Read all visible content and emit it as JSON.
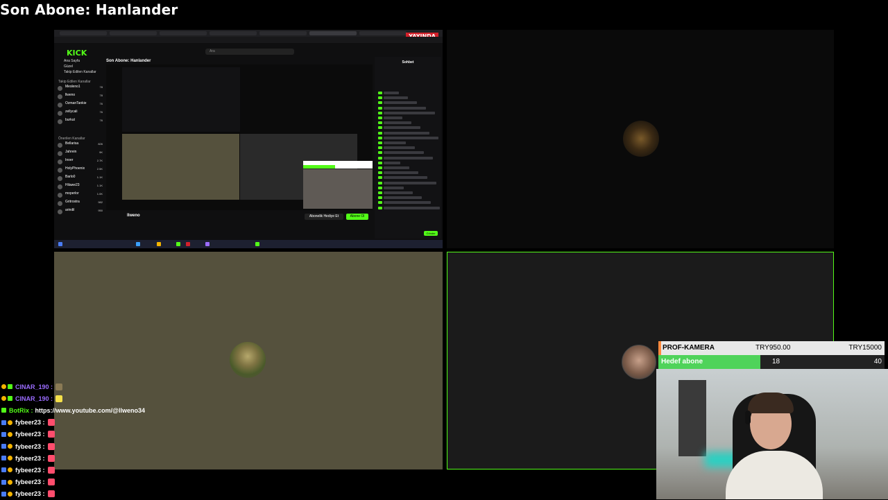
{
  "overlay": {
    "last_subscriber": "Son Abone: Hanlander"
  },
  "nested_screen": {
    "live_badge": "YAYINDA",
    "logo": "KICK",
    "search_placeholder": "Ara",
    "stream_title": "Son Abone: Hanlander",
    "streamer_name": "llweno",
    "chat_title": "Sohbet",
    "nav": [
      "Ana Sayfa",
      "Güzel",
      "Takip Edilen Kanallar"
    ],
    "followed_header": "Takip Edilen Kanallar",
    "followed": [
      {
        "name": "Mesleno1",
        "viewers": "78"
      },
      {
        "name": "llweno",
        "viewers": "78"
      },
      {
        "name": "OzmanTankie",
        "viewers": "76"
      },
      {
        "name": "zellycali",
        "viewers": "76"
      },
      {
        "name": "burkut",
        "viewers": "76"
      }
    ],
    "recommended_header": "Önerilen Kanallar",
    "recommended": [
      {
        "name": "Bellarisa",
        "viewers": "826"
      },
      {
        "name": "Jahrein",
        "viewers": "9K"
      },
      {
        "name": "Inoer",
        "viewers": "2.7K"
      },
      {
        "name": "HolyPhoenix",
        "viewers": "2.5K"
      },
      {
        "name": "Barlo0",
        "viewers": "1.1K"
      },
      {
        "name": "Hilawe23",
        "viewers": "1.1K"
      },
      {
        "name": "moperlor",
        "viewers": "1.0K"
      },
      {
        "name": "Gritrostra",
        "viewers": "982"
      },
      {
        "name": "arindil",
        "viewers": "950"
      }
    ],
    "subscribe_button": "Abonelik Hediye Et",
    "follow_button": "Abone Ol",
    "send_button": "Gönder"
  },
  "goal": {
    "row1_label": "PROF-KAMERA",
    "row1_current": "TRY950.00",
    "row1_target": "TRY15000",
    "row2_label": "Hedef abone",
    "row2_current": "18",
    "row2_target": "40",
    "row2_progress": 0.45,
    "accent_color": "#ff8a3d",
    "fill_color": "#4fd35a"
  },
  "chat": [
    {
      "badges": [
        "b-y",
        "b-g"
      ],
      "user": "CINAR_190",
      "color": "#9b6cff",
      "text": "",
      "emote": "#8a7a55"
    },
    {
      "badges": [
        "b-y",
        "b-g"
      ],
      "user": "CINAR_190",
      "color": "#9b6cff",
      "text": "",
      "emote": "#f4e04a"
    },
    {
      "badges": [
        "b-g"
      ],
      "user": "BotRix",
      "color": "#53fc18",
      "text": "https://www.youtube.com/@llweno34",
      "emote": ""
    },
    {
      "badges": [
        "b-b",
        "b-y"
      ],
      "user": "fybeer23",
      "color": "#ffffff",
      "text": "",
      "emote": "#ff4d6d"
    },
    {
      "badges": [
        "b-b",
        "b-y"
      ],
      "user": "fybeer23",
      "color": "#ffffff",
      "text": "",
      "emote": "#ff4d6d"
    },
    {
      "badges": [
        "b-b",
        "b-y"
      ],
      "user": "fybeer23",
      "color": "#ffffff",
      "text": "",
      "emote": "#ff4d6d"
    },
    {
      "badges": [
        "b-b",
        "b-y"
      ],
      "user": "fybeer23",
      "color": "#ffffff",
      "text": "",
      "emote": "#ff4d6d"
    },
    {
      "badges": [
        "b-b",
        "b-y"
      ],
      "user": "fybeer23",
      "color": "#ffffff",
      "text": "",
      "emote": "#ff4d6d"
    },
    {
      "badges": [
        "b-b",
        "b-y"
      ],
      "user": "fybeer23",
      "color": "#ffffff",
      "text": "",
      "emote": "#ff4d6d"
    },
    {
      "badges": [
        "b-b",
        "b-y"
      ],
      "user": "fybeer23",
      "color": "#ffffff",
      "text": "",
      "emote": "#ff4d6d"
    }
  ]
}
